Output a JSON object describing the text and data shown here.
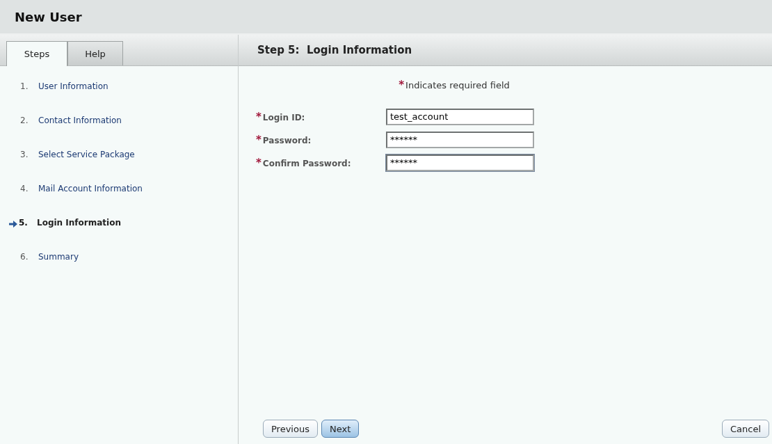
{
  "window": {
    "title": "New User"
  },
  "tabs": [
    {
      "label": "Steps",
      "selected": true
    },
    {
      "label": "Help",
      "selected": false
    }
  ],
  "steps": [
    {
      "number": "1.",
      "label": "User Information",
      "selected": false
    },
    {
      "number": "2.",
      "label": "Contact Information",
      "selected": false
    },
    {
      "number": "3.",
      "label": "Select Service Package",
      "selected": false
    },
    {
      "number": "4.",
      "label": "Mail Account Information",
      "selected": false
    },
    {
      "number": "5.",
      "label": "Login Information",
      "selected": true
    },
    {
      "number": "6.",
      "label": "Summary",
      "selected": false
    }
  ],
  "content": {
    "title": "Step 5:  Login Information",
    "required_mark": "*",
    "required_note": "Indicates required field",
    "fields": [
      {
        "label": "Login ID:",
        "value": "test_account",
        "required": true,
        "focused": false
      },
      {
        "label": "Password:",
        "value": "******",
        "required": true,
        "focused": false
      },
      {
        "label": "Confirm Password:",
        "value": "******",
        "required": true,
        "focused": true
      }
    ]
  },
  "buttons": [
    {
      "label": "Previous",
      "primary": false
    },
    {
      "label": "Next",
      "primary": true
    },
    {
      "label": "Cancel",
      "primary": false
    }
  ]
}
